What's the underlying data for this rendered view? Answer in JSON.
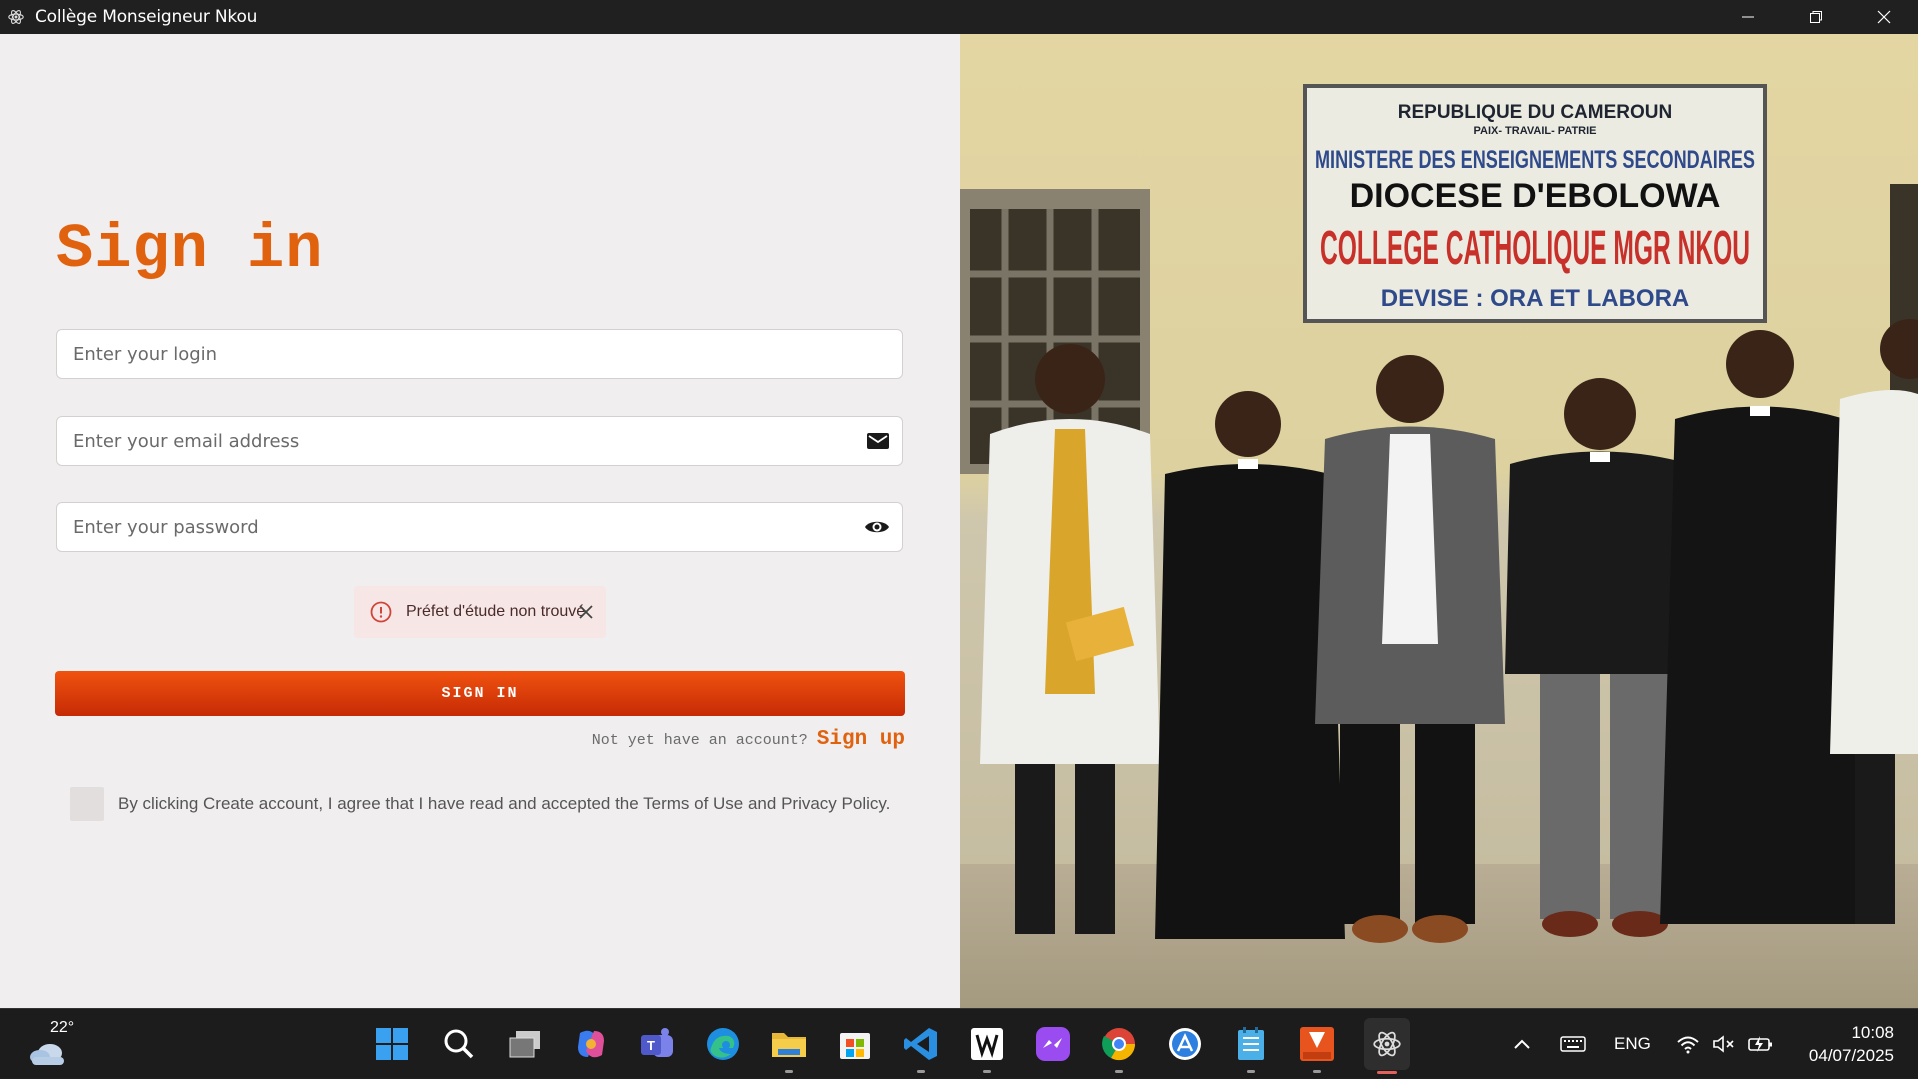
{
  "window": {
    "title": "Collège Monseigneur Nkou",
    "icons": {
      "app": "atom-app-icon",
      "minimize": "minimize-icon",
      "maximize": "restore-icon",
      "close": "close-icon"
    }
  },
  "form": {
    "heading": "Sign in",
    "login_placeholder": "Enter your login",
    "email_placeholder": "Enter your email address",
    "password_placeholder": "Enter your password",
    "email_icon": "envelope-icon",
    "password_icon": "eye-icon",
    "error_message": "Préfet d'étude non trouvé",
    "signin_button": "SIGN IN",
    "signup_question": "Not yet have an account?",
    "signup_link": "Sign up",
    "terms_text": "By clicking Create account, I agree that I have read and accepted the Terms of Use and Privacy Policy."
  },
  "photo": {
    "sign_lines": [
      "REPUBLIQUE DU CAMEROUN",
      "PAIX- TRAVAIL- PATRIE",
      "MINISTERE DES ENSEIGNEMENTS SECONDAIRES",
      "DIOCESE D'EBOLOWA",
      "COLLEGE CATHOLIQUE MGR NKOU",
      "DEVISE : ORA ET LABORA"
    ]
  },
  "taskbar": {
    "weather_temp": "22°",
    "apps": [
      "start-icon",
      "search-icon",
      "task-view-icon",
      "copilot-icon",
      "teams-icon",
      "edge-icon",
      "file-explorer-icon",
      "store-icon",
      "vscode-icon",
      "notion-icon",
      "messenger-icon",
      "chrome-icon",
      "app-store-icon",
      "notepad-icon",
      "reader-icon",
      "atom-app-icon"
    ],
    "language": "ENG",
    "time": "10:08",
    "date": "04/07/2025"
  },
  "colors": {
    "accent": "#e0620f",
    "button_top": "#f0530f",
    "button_bottom": "#c62a05",
    "panel_bg": "#f0eeee",
    "alert_bg": "#f6e7e6",
    "alert_icon": "#d0443a"
  }
}
